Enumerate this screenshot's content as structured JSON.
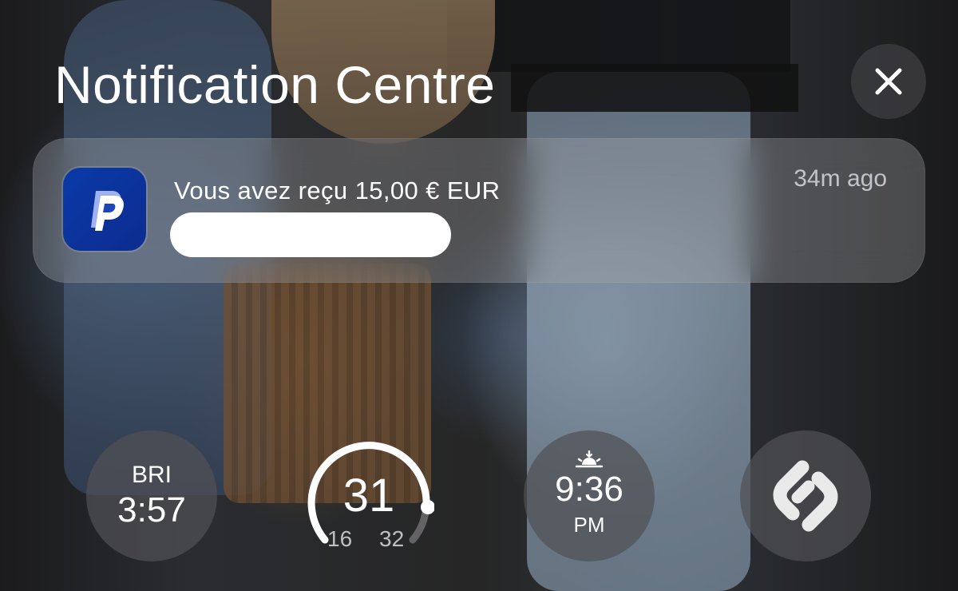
{
  "header": {
    "title": "Notification Centre"
  },
  "close_button": {
    "icon": "close-icon"
  },
  "notification": {
    "app_icon": "paypal-icon",
    "title": "Vous avez reçu 15,00 € EUR",
    "time": "34m ago"
  },
  "widgets": {
    "world_clock": {
      "city": "BRI",
      "time": "3:57"
    },
    "temperature": {
      "current": "31",
      "low": "16",
      "high": "32"
    },
    "sunrise": {
      "icon": "sunrise-icon",
      "time": "9:36",
      "ampm": "PM"
    },
    "shazam": {
      "icon": "shazam-icon"
    }
  },
  "colors": {
    "paypal_blue": "#0a3aa8",
    "widget_bg": "#505054",
    "notification_bg": "#aaaaaf"
  }
}
